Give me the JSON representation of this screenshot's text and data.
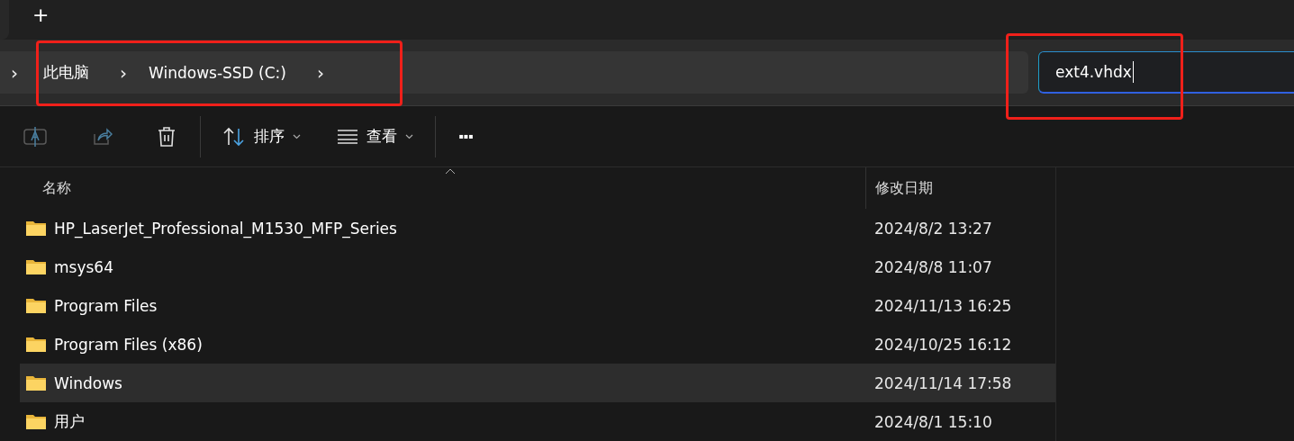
{
  "tab_strip": {
    "new_tab": "+"
  },
  "address_bar": {
    "highlighted": true,
    "separator": "›",
    "crumbs": [
      "此电脑",
      "Windows-SSD (C:)"
    ]
  },
  "search": {
    "value": "ext4.vhdx",
    "highlighted": true,
    "focused": true
  },
  "toolbar": {
    "sort": "排序",
    "view": "查看",
    "more": "···"
  },
  "table": {
    "columns": [
      "名称",
      "修改日期"
    ],
    "rows": [
      {
        "name": "HP_LaserJet_Professional_M1530_MFP_Series",
        "modified": "2024/8/2 13:27",
        "selected": false
      },
      {
        "name": "msys64",
        "modified": "2024/8/8 11:07",
        "selected": false
      },
      {
        "name": "Program Files",
        "modified": "2024/11/13 16:25",
        "selected": false
      },
      {
        "name": "Program Files (x86)",
        "modified": "2024/10/25 16:12",
        "selected": false
      },
      {
        "name": "Windows",
        "modified": "2024/11/14 17:58",
        "selected": true
      },
      {
        "name": "用户",
        "modified": "2024/8/1 15:10",
        "selected": false
      }
    ]
  }
}
